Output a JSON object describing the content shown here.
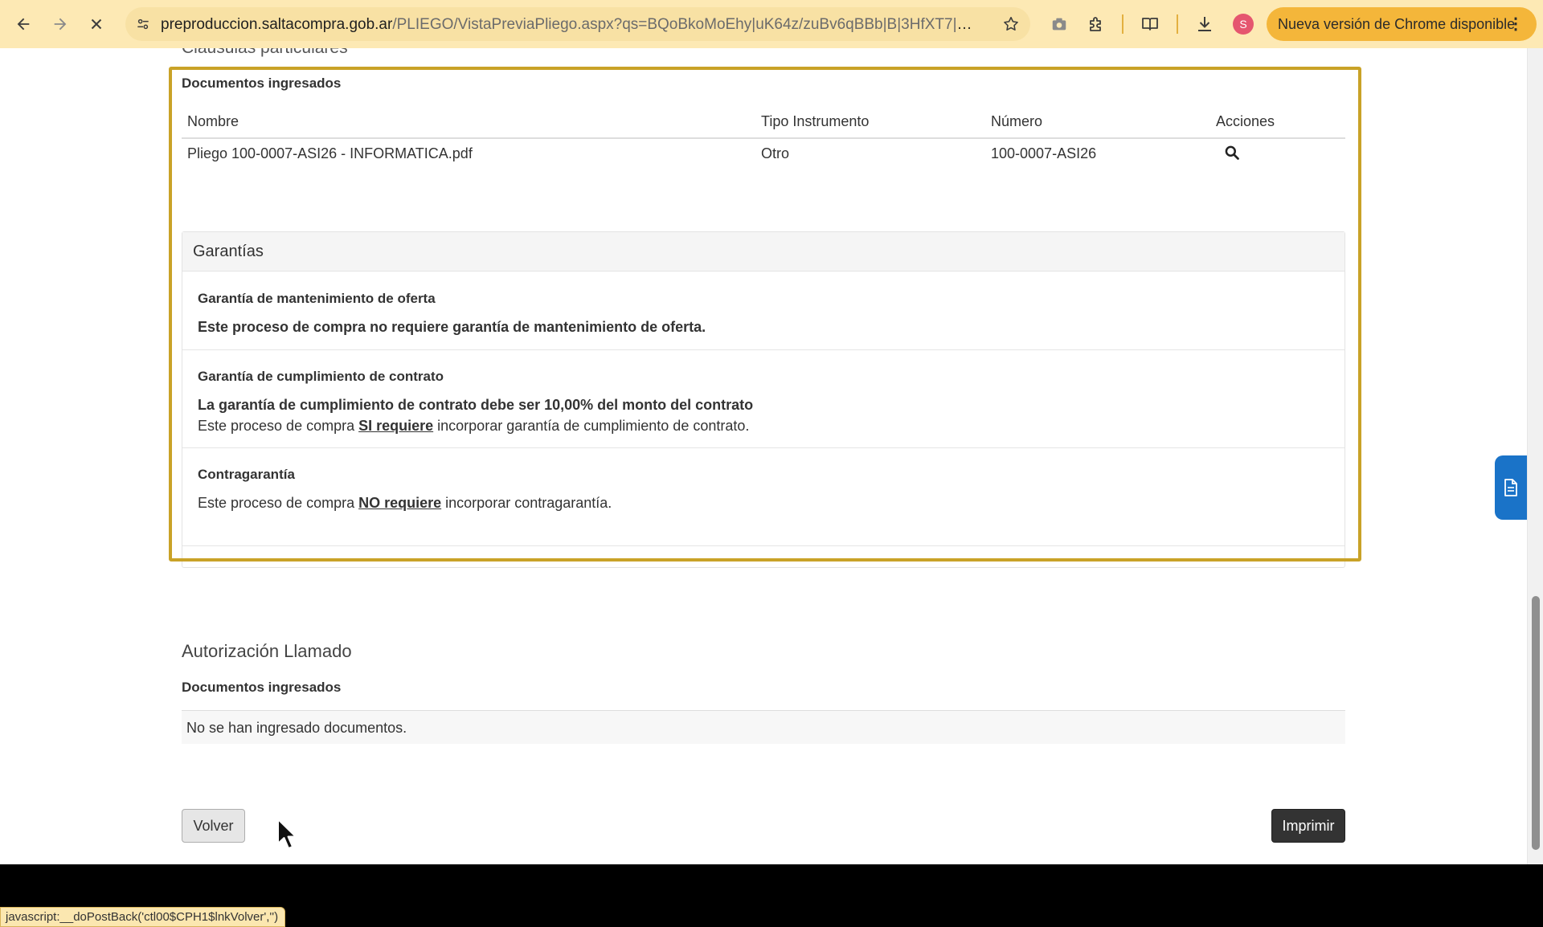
{
  "browser": {
    "url_host": "preproduccion.saltacompra.gob.ar",
    "url_path": "/PLIEGO/VistaPreviaPliego.aspx?qs=BQoBkoMoEhy|uK64z/zuBv6qBBb|B|3HfXT7|ozn7...",
    "profile_initial": "S",
    "update_label": "Nueva versión de Chrome disponible",
    "update_menu": "⋮",
    "status_url": "javascript:__doPostBack('ctl00$CPH1$lnkVolver','')"
  },
  "clausulas": {
    "cut_title": "Cláusulas particulares",
    "docs_label": "Documentos ingresados",
    "columns": [
      "Nombre",
      "Tipo Instrumento",
      "Número",
      "Acciones"
    ],
    "rows": [
      {
        "nombre": "Pliego 100-0007-ASI26 - INFORMATICA.pdf",
        "tipo": "Otro",
        "numero": "100-0007-ASI26"
      }
    ]
  },
  "garantias": {
    "title": "Garantías",
    "mantenimiento": {
      "title": "Garantía de mantenimiento de oferta",
      "bold_text": "Este proceso de compra no requiere garantía de mantenimiento de oferta."
    },
    "cumplimiento": {
      "title": "Garantía de cumplimiento de contrato",
      "bold_text": "La garantía de cumplimiento de contrato debe ser 10,00% del monto del contrato",
      "text_before": "Este proceso de compra ",
      "text_underline": "SI requiere",
      "text_after": " incorporar garantía de cumplimiento de contrato."
    },
    "contragarantia": {
      "title": "Contragarantía",
      "text_before": "Este proceso de compra ",
      "text_underline": "NO requiere",
      "text_after": " incorporar contragarantía."
    }
  },
  "autorizacion": {
    "title": "Autorización Llamado",
    "docs_label": "Documentos ingresados",
    "empty_text": "No se han ingresado documentos."
  },
  "buttons": {
    "volver": "Volver",
    "imprimir": "Imprimir"
  },
  "colors": {
    "highlight_border": "#c9a227",
    "toolbar_bg": "#fde9b4",
    "update_pill": "#f4b63a",
    "primary_dark": "#333333",
    "floating_tab": "#1a73c8"
  },
  "icons": [
    "back-arrow-icon",
    "forward-arrow-icon",
    "stop-loading-icon",
    "site-settings-icon",
    "bookmark-star-icon",
    "screenshot-camera-icon",
    "extensions-puzzle-icon",
    "reading-mode-icon",
    "download-icon",
    "search-magnifier-icon",
    "document-icon",
    "mouse-pointer-icon"
  ]
}
